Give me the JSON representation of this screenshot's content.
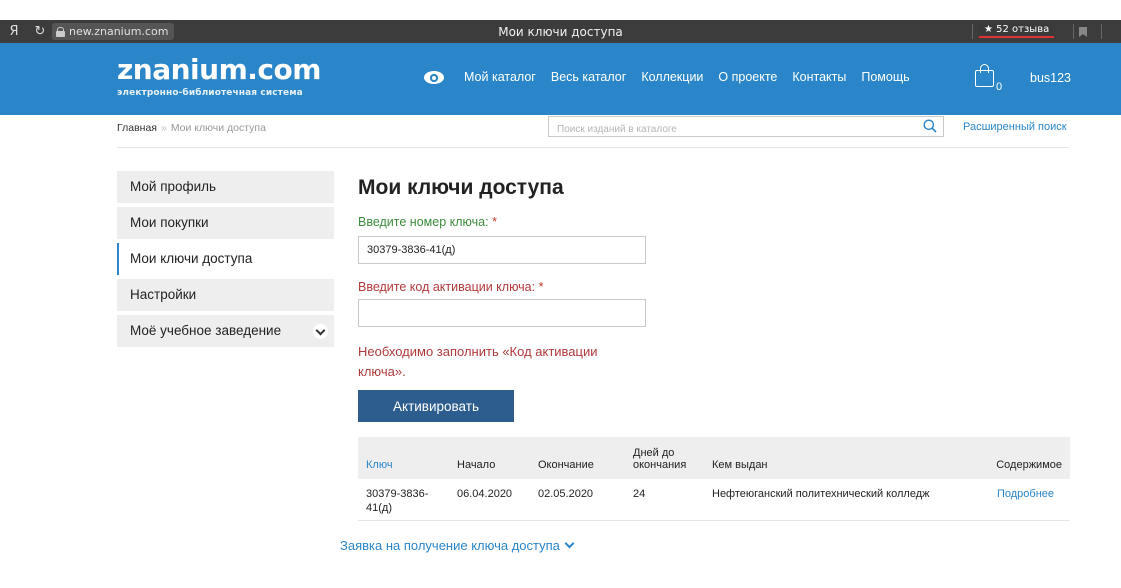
{
  "browser": {
    "ya_label": "Я",
    "reload_icon": "reload-icon",
    "url": "new.znanium.com",
    "title": "Мои ключи доступа",
    "reviews": "★ 52 отзыва"
  },
  "header": {
    "logo_main": "znanium.com",
    "logo_sub": "электронно-библиотечная система",
    "nav": [
      "Мой каталог",
      "Весь каталог",
      "Коллекции",
      "О проекте",
      "Контакты",
      "Помощь"
    ],
    "cart_count": "0",
    "user": "bus123"
  },
  "breadcrumb": {
    "home": "Главная",
    "separator": "»",
    "current": "Мои ключи доступа"
  },
  "search": {
    "placeholder": "Поиск изданий в каталоге",
    "advanced": "Расширенный поиск"
  },
  "sidebar": {
    "items": [
      {
        "label": "Мой профиль",
        "active": false
      },
      {
        "label": "Мои покупки",
        "active": false
      },
      {
        "label": "Мои ключи доступа",
        "active": true
      },
      {
        "label": "Настройки",
        "active": false
      },
      {
        "label": "Моё учебное заведение",
        "active": false
      }
    ]
  },
  "main": {
    "title": "Мои ключи доступа",
    "key_label": "Введите номер ключа:",
    "key_value": "30379-3836-41(д)",
    "code_label": "Введите код активации ключа:",
    "code_value": "",
    "required_mark": "*",
    "error": "Необходимо заполнить «Код активации ключа».",
    "activate_button": "Активировать",
    "request_link": "Заявка на получение ключа доступа"
  },
  "table": {
    "headers": [
      "Ключ",
      "Начало",
      "Окончание",
      "Дней до окончания",
      "Кем выдан",
      "Содержимое"
    ],
    "rows": [
      {
        "key": "30379-3836-41(д)",
        "start": "06.04.2020",
        "end": "02.05.2020",
        "days_left": "24",
        "issuer": "Нефтеюганский политехнический колледж",
        "content": "Подробнее"
      }
    ]
  },
  "colors": {
    "header_blue": "#2a86c8",
    "button_blue": "#2d5d8f",
    "error_red": "#b03a3a",
    "label_green": "#3d8c3d"
  }
}
